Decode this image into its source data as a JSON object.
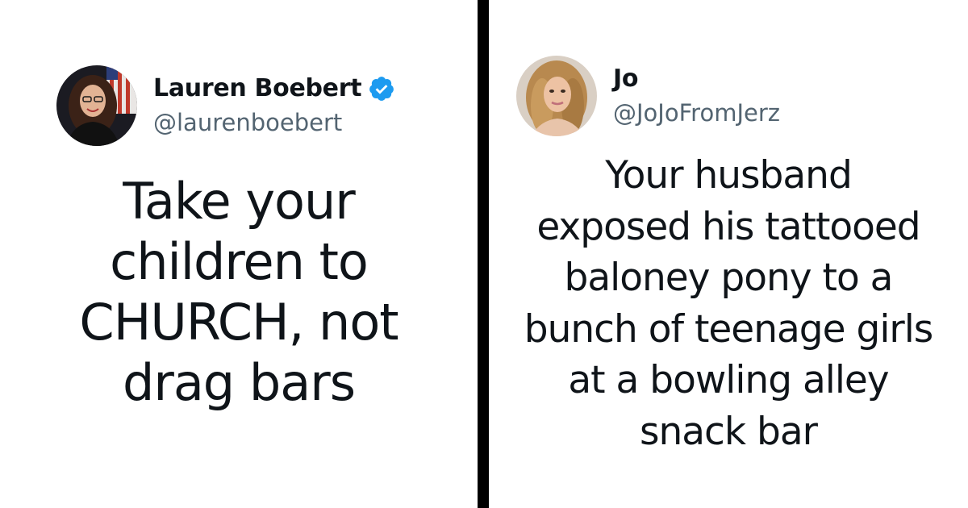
{
  "tweets": [
    {
      "display_name": "Lauren Boebert",
      "handle": "@laurenboebert",
      "verified": true,
      "avatar_icon": "user-photo-avatar",
      "text": "Take your\nchildren to\nCHURCH, not\ndrag bars"
    },
    {
      "display_name": "Jo",
      "handle": "@JoJoFromJerz",
      "verified": false,
      "avatar_icon": "user-photo-avatar",
      "text": "Your husband\nexposed his tattooed\nbaloney pony to a\nbunch of teenage girls\nat a bowling alley\nsnack bar"
    }
  ],
  "colors": {
    "verified_badge": "#1d9bf0",
    "name_text": "#0f1419",
    "handle_text": "#536471",
    "divider": "#000000"
  }
}
